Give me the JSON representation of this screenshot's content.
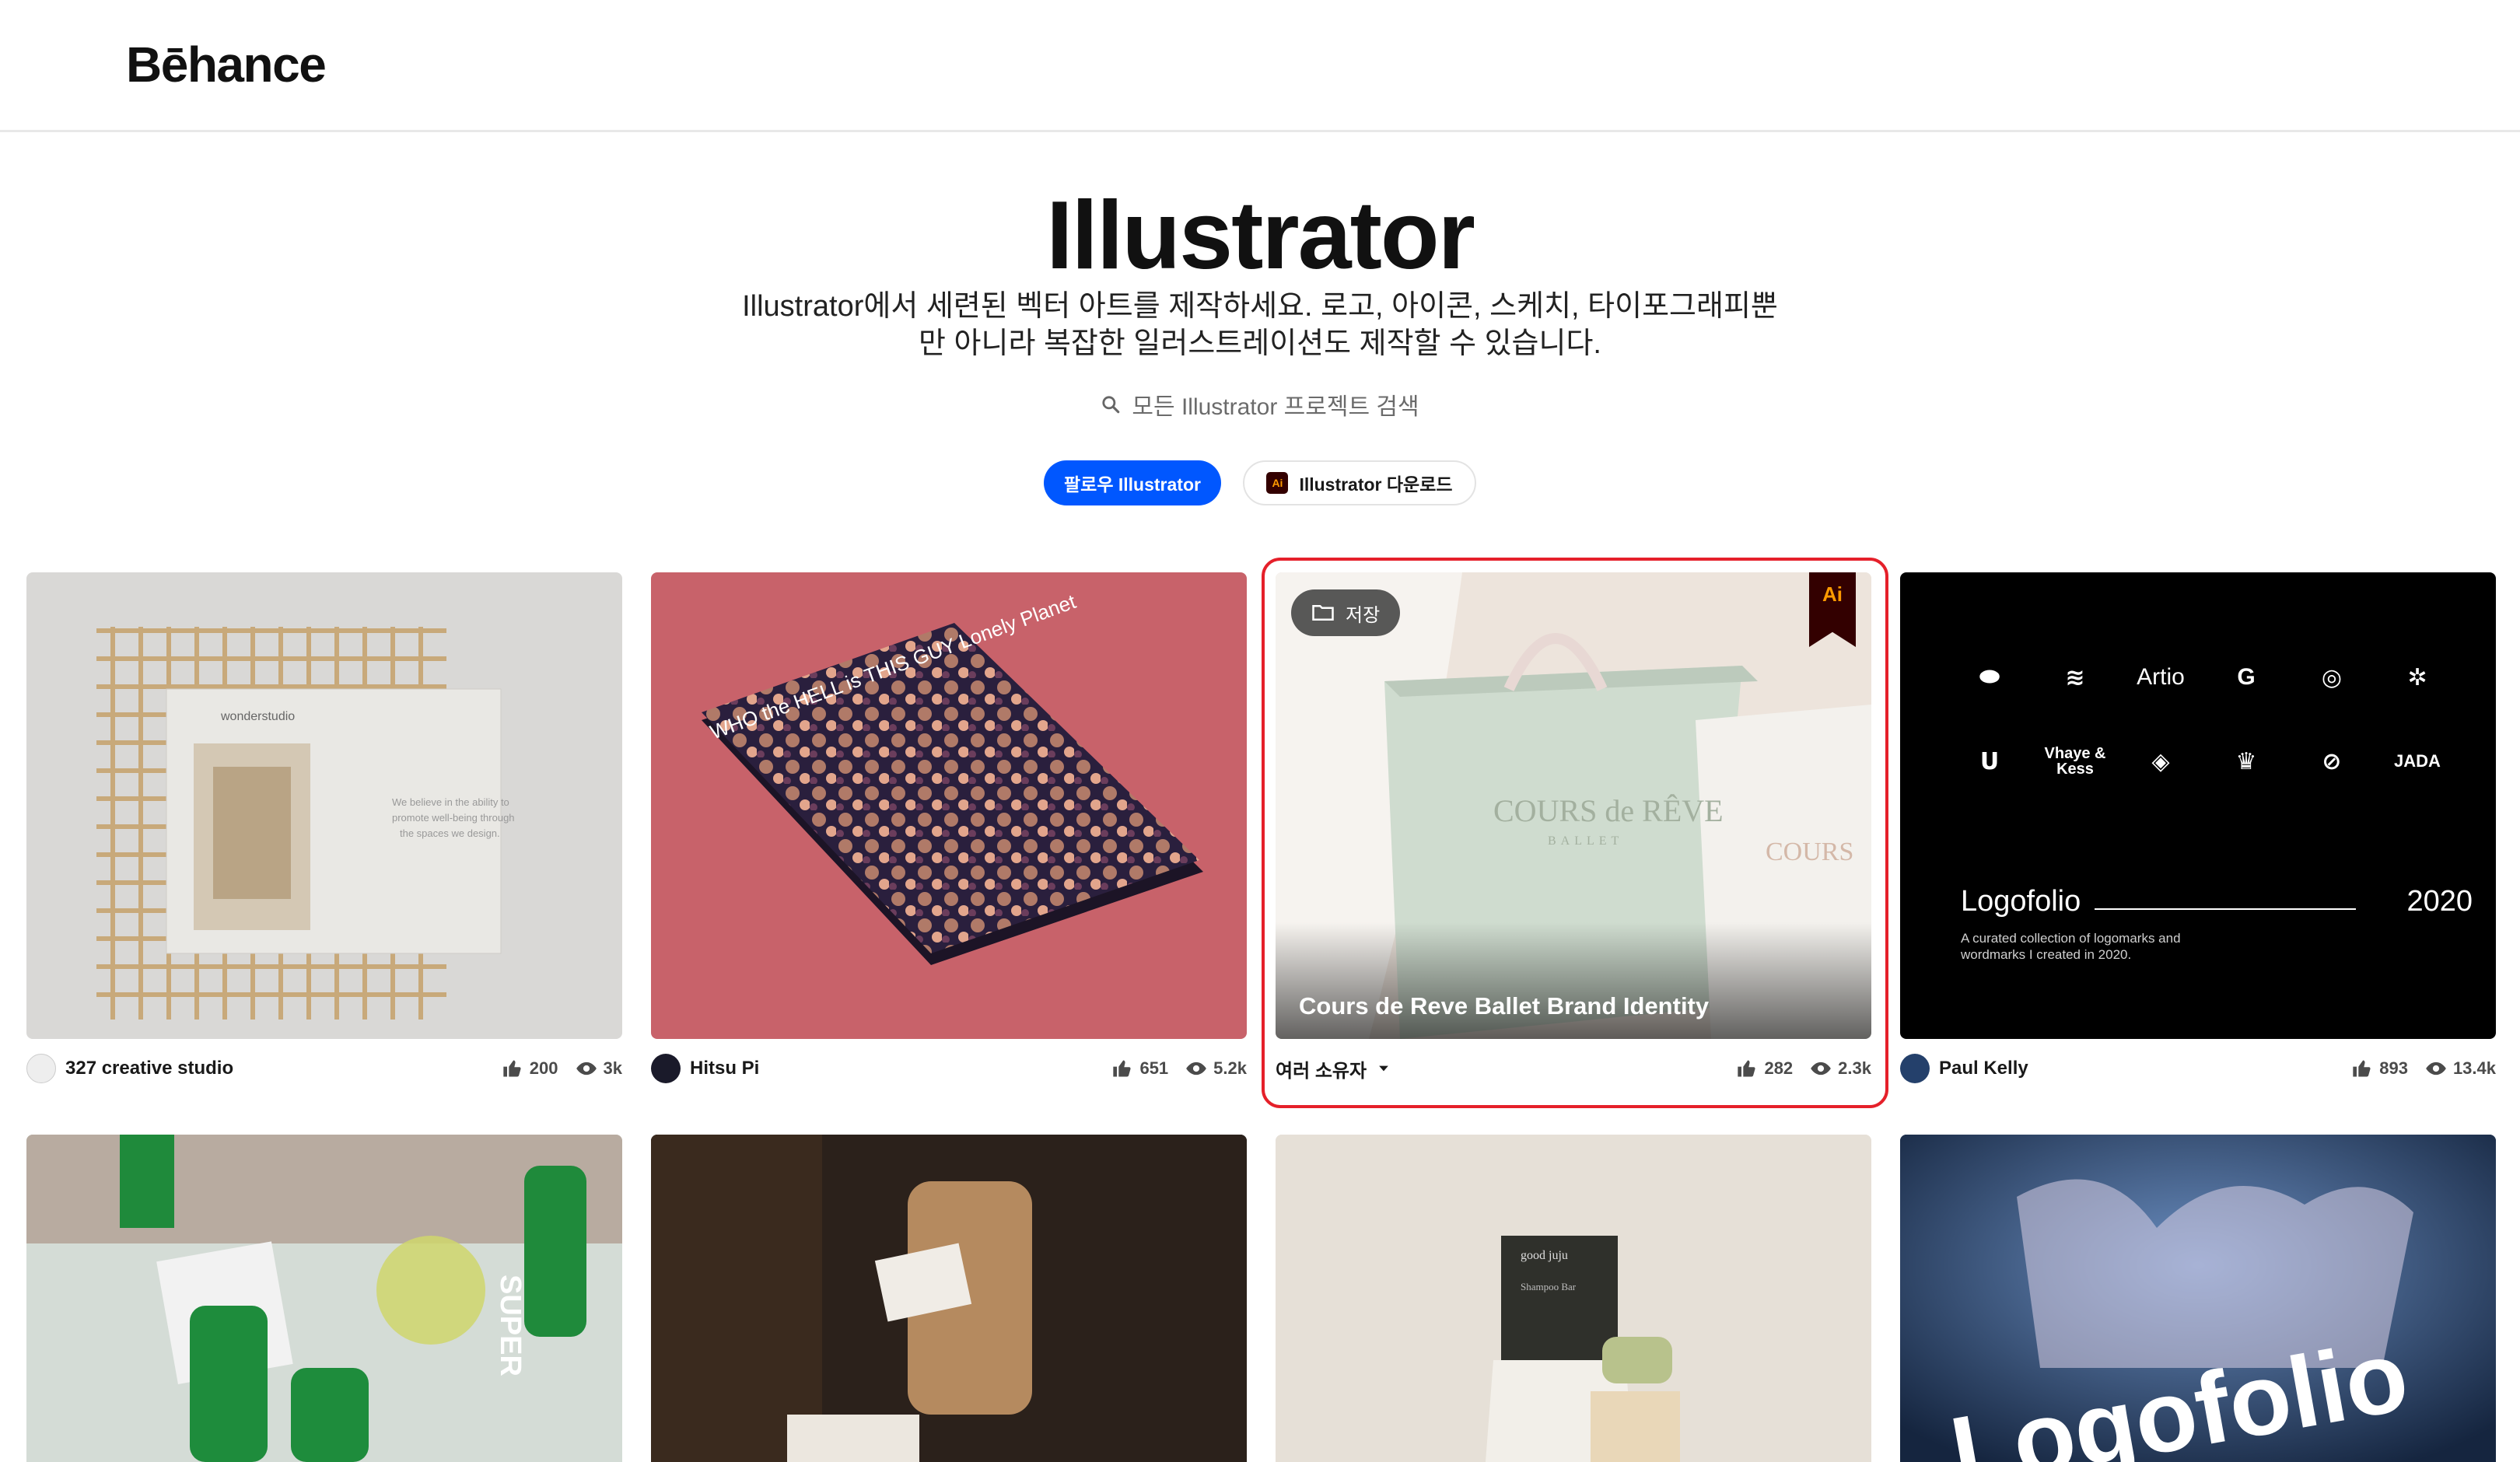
{
  "header": {
    "logo": "Bēhance"
  },
  "hero": {
    "title": "Illustrator",
    "description_line1": "Illustrator에서 세련된 벡터 아트를 제작하세요. 로고, 아이콘, 스케치, 타이포그래피뿐",
    "description_line2": "만 아니라 복잡한 일러스트레이션도 제작할 수 있습니다.",
    "search_label": "모든 Illustrator 프로젝트 검색",
    "follow_button": "팔로우 Illustrator",
    "download_button": "Illustrator 다운로드",
    "download_icon_text": "Ai"
  },
  "cards": [
    {
      "owner": "327 creative studio",
      "likes": "200",
      "views": "3k"
    },
    {
      "owner": "Hitsu Pi",
      "likes": "651",
      "views": "5.2k",
      "art_text": "WHO the HELL is THIS GUY  Lonely Planet"
    },
    {
      "owner": "여러 소유자",
      "likes": "282",
      "views": "2.3k",
      "title": "Cours de Reve Ballet Brand Identity",
      "save_label": "저장",
      "badge": "Ai",
      "art_text": "COURS de RÊVE",
      "art_sub": "BALLET",
      "art_text_small": "COURS"
    },
    {
      "owner": "Paul Kelly",
      "likes": "893",
      "views": "13.4k",
      "art_marks": [
        "Artio",
        "Vhaye & Kess",
        "JADA"
      ],
      "art_title": "Logofolio",
      "art_year": "2020",
      "art_sub": "A curated collection of logomarks and wordmarks I created in 2020."
    },
    {
      "art_text": "SUPER"
    },
    {
      "art_text": ""
    },
    {
      "art_text": "good juju",
      "art_sub": "Shampoo Bar"
    },
    {
      "art_text": "Logofolio"
    }
  ],
  "colors": {
    "accent": "#0057ff",
    "highlight": "#e5202a",
    "ai_bg": "#330000",
    "ai_fg": "#ff9a00"
  },
  "icons": {
    "search": "search-icon",
    "like": "thumbs-up-icon",
    "view": "eye-icon",
    "folder": "folder-icon",
    "dropdown": "chevron-down-icon"
  }
}
